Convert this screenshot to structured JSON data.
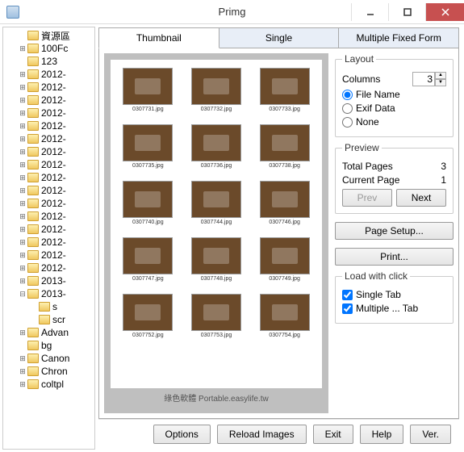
{
  "window": {
    "title": "Primg"
  },
  "tree": {
    "items": [
      {
        "label": "資源區",
        "depth": 1,
        "exp": ""
      },
      {
        "label": "100Fc",
        "depth": 1,
        "exp": "+"
      },
      {
        "label": "123",
        "depth": 1,
        "exp": ""
      },
      {
        "label": "2012-",
        "depth": 1,
        "exp": "+"
      },
      {
        "label": "2012-",
        "depth": 1,
        "exp": "+"
      },
      {
        "label": "2012-",
        "depth": 1,
        "exp": "+"
      },
      {
        "label": "2012-",
        "depth": 1,
        "exp": "+"
      },
      {
        "label": "2012-",
        "depth": 1,
        "exp": "+"
      },
      {
        "label": "2012-",
        "depth": 1,
        "exp": "+"
      },
      {
        "label": "2012-",
        "depth": 1,
        "exp": "+"
      },
      {
        "label": "2012-",
        "depth": 1,
        "exp": "+"
      },
      {
        "label": "2012-",
        "depth": 1,
        "exp": "+"
      },
      {
        "label": "2012-",
        "depth": 1,
        "exp": "+"
      },
      {
        "label": "2012-",
        "depth": 1,
        "exp": "+"
      },
      {
        "label": "2012-",
        "depth": 1,
        "exp": "+"
      },
      {
        "label": "2012-",
        "depth": 1,
        "exp": "+"
      },
      {
        "label": "2012-",
        "depth": 1,
        "exp": "+"
      },
      {
        "label": "2012-",
        "depth": 1,
        "exp": "+"
      },
      {
        "label": "2012-",
        "depth": 1,
        "exp": "+"
      },
      {
        "label": "2013-",
        "depth": 1,
        "exp": "+"
      },
      {
        "label": "2013-",
        "depth": 1,
        "exp": "−"
      },
      {
        "label": "s",
        "depth": 2,
        "exp": ""
      },
      {
        "label": "scr",
        "depth": 2,
        "exp": ""
      },
      {
        "label": "Advan",
        "depth": 1,
        "exp": "+"
      },
      {
        "label": "bg",
        "depth": 1,
        "exp": ""
      },
      {
        "label": "Canon",
        "depth": 1,
        "exp": "+"
      },
      {
        "label": "Chron",
        "depth": 1,
        "exp": "+"
      },
      {
        "label": "coltpl",
        "depth": 1,
        "exp": "+"
      }
    ]
  },
  "tabs": {
    "thumbnail": "Thumbnail",
    "single": "Single",
    "multiple": "Multiple Fixed Form"
  },
  "thumbs": [
    "0307731.jpg",
    "0307732.jpg",
    "0307733.jpg",
    "0307735.jpg",
    "0307736.jpg",
    "0307738.jpg",
    "0307740.jpg",
    "0307744.jpg",
    "0307746.jpg",
    "0307747.jpg",
    "0307748.jpg",
    "0307749.jpg",
    "0307752.jpg",
    "0307753.jpg",
    "0307754.jpg"
  ],
  "watermark": "綠色軟體 Portable.easylife.tw",
  "layout": {
    "legend": "Layout",
    "columns_label": "Columns",
    "columns_value": "3",
    "radio_filename": "File Name",
    "radio_exif": "Exif Data",
    "radio_none": "None"
  },
  "preview": {
    "legend": "Preview",
    "total_label": "Total Pages",
    "total_value": "3",
    "current_label": "Current Page",
    "current_value": "1",
    "prev": "Prev",
    "next": "Next"
  },
  "buttons": {
    "page_setup": "Page Setup...",
    "print": "Print..."
  },
  "load": {
    "legend": "Load with click",
    "single": "Single Tab",
    "multiple": "Multiple ... Tab"
  },
  "bottom": {
    "options": "Options",
    "reload": "Reload Images",
    "exit": "Exit",
    "help": "Help",
    "ver": "Ver."
  }
}
